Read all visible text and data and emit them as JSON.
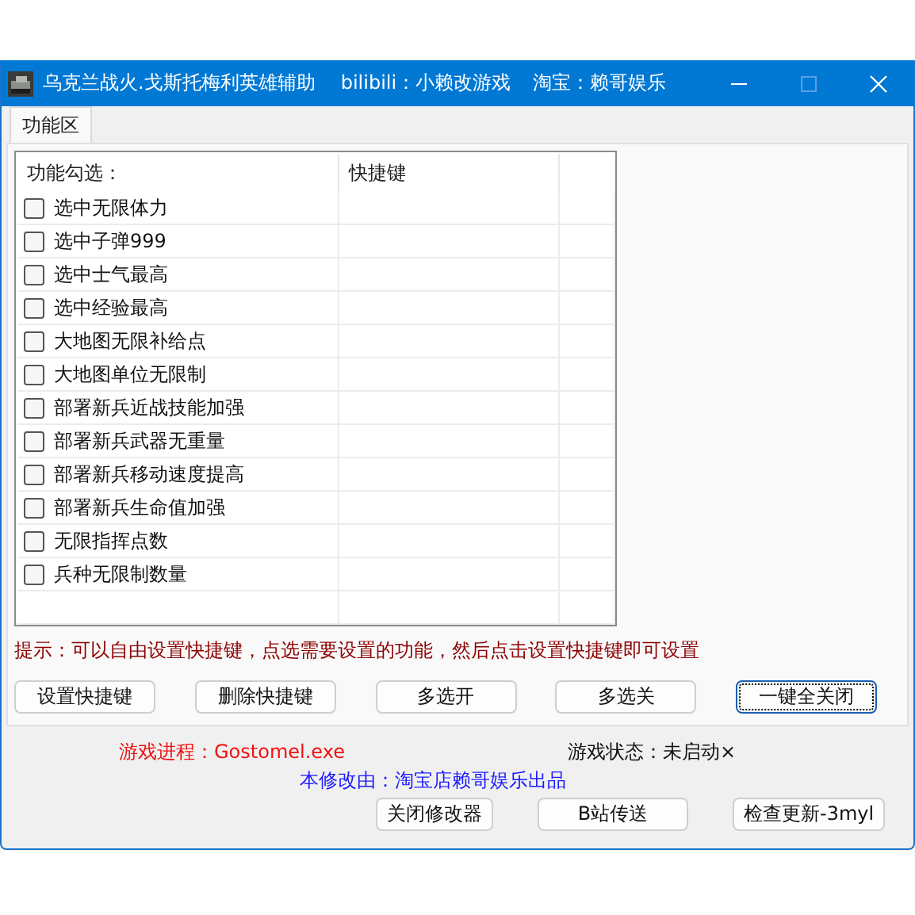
{
  "window": {
    "title": "乌克兰战火.戈斯托梅利英雄辅助",
    "title_extras": [
      "bilibili：小赖改游戏",
      "淘宝：赖哥娱乐"
    ]
  },
  "tabs": [
    {
      "label": "功能区",
      "selected": true
    }
  ],
  "table": {
    "columns": [
      "功能勾选：",
      "快捷键"
    ],
    "rows": [
      {
        "label": "选中无限体力",
        "checked": false
      },
      {
        "label": "选中子弹999",
        "checked": false
      },
      {
        "label": "选中士气最高",
        "checked": false
      },
      {
        "label": "选中经验最高",
        "checked": false
      },
      {
        "label": "大地图无限补给点",
        "checked": false
      },
      {
        "label": "大地图单位无限制",
        "checked": false
      },
      {
        "label": "部署新兵近战技能加强",
        "checked": false
      },
      {
        "label": "部署新兵武器无重量",
        "checked": false
      },
      {
        "label": "部署新兵移动速度提高",
        "checked": false
      },
      {
        "label": "部署新兵生命值加强",
        "checked": false
      },
      {
        "label": "无限指挥点数",
        "checked": false
      },
      {
        "label": "兵种无限制数量",
        "checked": false
      }
    ]
  },
  "hint": "提示：可以自由设置快捷键，点选需要设置的功能，然后点击设置快捷键即可设置",
  "buttons": [
    {
      "label": "设置快捷键",
      "focused": false
    },
    {
      "label": "删除快捷键",
      "focused": false
    },
    {
      "label": "多选开",
      "focused": false
    },
    {
      "label": "多选关",
      "focused": false
    },
    {
      "label": "一键全关闭",
      "focused": true
    }
  ],
  "process": "游戏进程：Gostomel.exe",
  "status": "游戏状态：未启动×",
  "credit": "本修改由：淘宝店赖哥娱乐出品",
  "bottom_buttons": [
    "关闭修改器",
    "B站传送",
    "检查更新-3myl"
  ]
}
